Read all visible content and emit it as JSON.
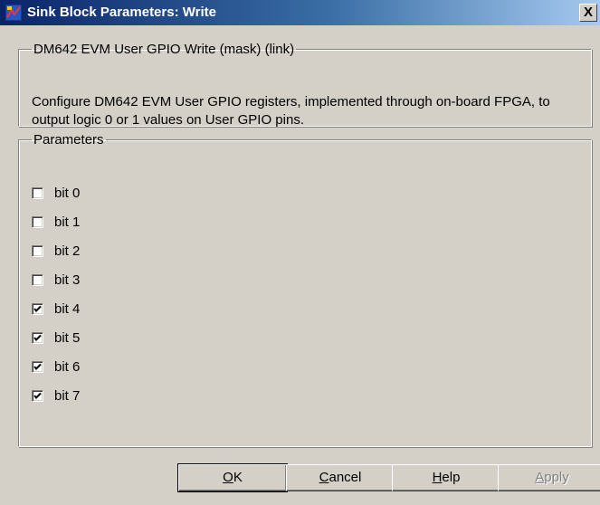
{
  "window": {
    "title": "Sink Block Parameters: Write",
    "close_label": "X"
  },
  "description_group": {
    "legend": "DM642 EVM User GPIO Write (mask) (link)",
    "text": "Configure DM642 EVM User GPIO registers, implemented through on-board FPGA, to output logic 0 or 1 values on User GPIO pins."
  },
  "parameters_group": {
    "legend": "Parameters",
    "checkboxes": [
      {
        "label": "bit 0",
        "checked": false
      },
      {
        "label": "bit 1",
        "checked": false
      },
      {
        "label": "bit 2",
        "checked": false
      },
      {
        "label": "bit 3",
        "checked": false
      },
      {
        "label": "bit 4",
        "checked": true
      },
      {
        "label": "bit 5",
        "checked": true
      },
      {
        "label": "bit 6",
        "checked": true
      },
      {
        "label": "bit 7",
        "checked": true
      }
    ]
  },
  "buttons": {
    "ok": {
      "mnemonic": "O",
      "rest": "K"
    },
    "cancel": {
      "mnemonic": "C",
      "rest": "ancel"
    },
    "help": {
      "mnemonic": "H",
      "rest": "elp"
    },
    "apply": {
      "mnemonic": "A",
      "rest": "pply",
      "enabled": false
    }
  }
}
